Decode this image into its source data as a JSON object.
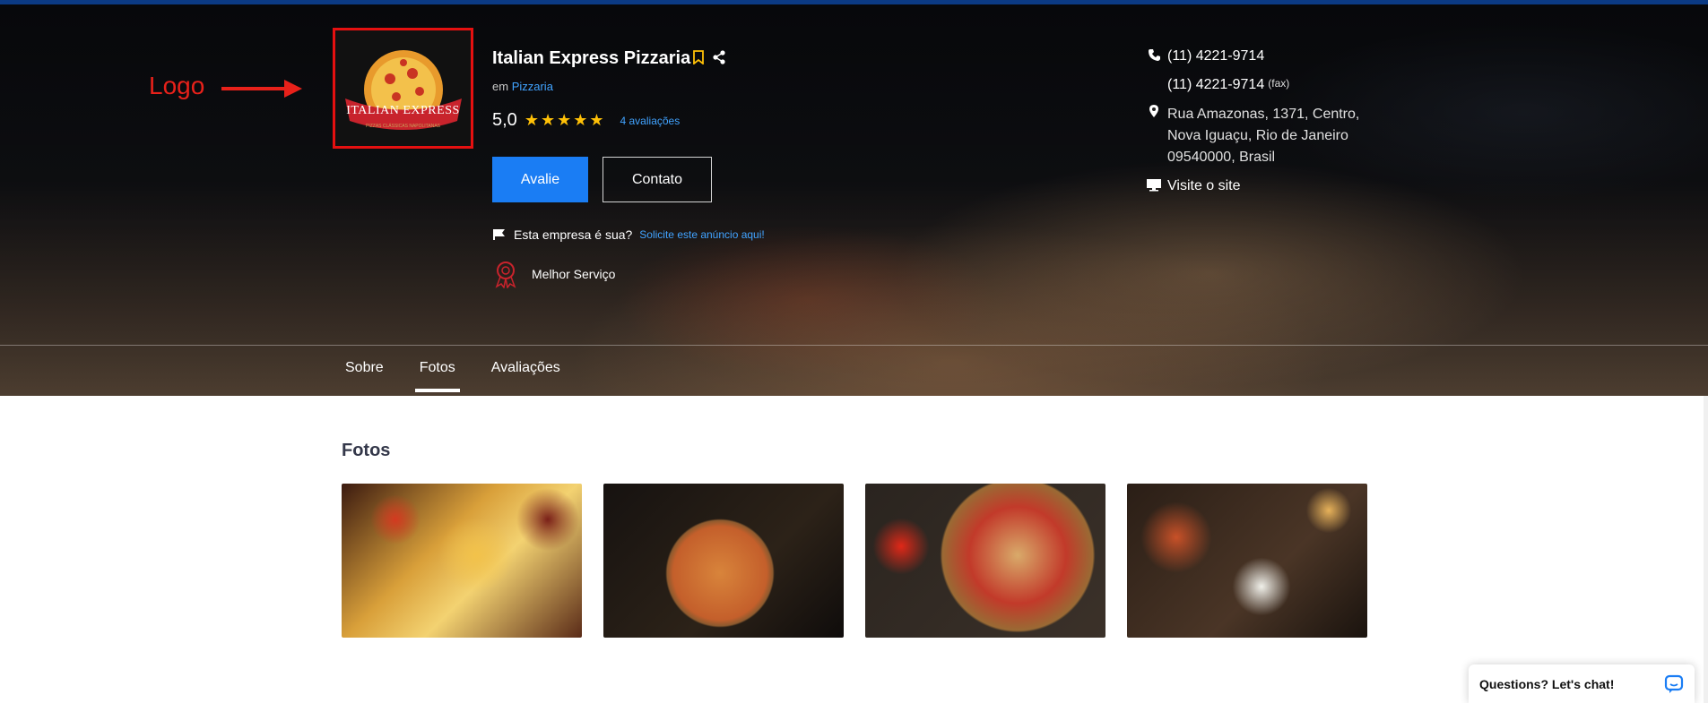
{
  "annotation": {
    "label": "Logo"
  },
  "logo": {
    "text": "ITALIAN EXPRESS",
    "subtext": "PIZZAS CLÁSSICAS NAPOLITANAS"
  },
  "business": {
    "name": "Italian Express Pizzaria",
    "category_prefix": "em",
    "category": "Pizzaria",
    "rating": "5,0",
    "stars": 5,
    "reviews_label": "4 avaliações"
  },
  "actions": {
    "review_label": "Avalie",
    "contact_label": "Contato"
  },
  "claim": {
    "question": "Esta empresa é sua?",
    "link": "Solicite este anúncio aqui!"
  },
  "badge": {
    "label": "Melhor Serviço"
  },
  "contact": {
    "phone": "(11) 4221-9714",
    "fax": "(11) 4221-9714",
    "fax_suffix": "(fax)",
    "address_line1": "Rua Amazonas, 1371, Centro,",
    "address_line2": "Nova Iguaçu, Rio de Janeiro",
    "address_line3": "09540000, Brasil",
    "website_label": "Visite o site"
  },
  "tabs": [
    {
      "label": "Sobre",
      "active": false
    },
    {
      "label": "Fotos",
      "active": true
    },
    {
      "label": "Avaliações",
      "active": false
    }
  ],
  "photos_section": {
    "title": "Fotos"
  },
  "chat": {
    "label": "Questions? Let's chat!"
  },
  "colors": {
    "accent": "#1a7df4",
    "link": "#41a3ff",
    "star": "#ffc107",
    "annotation": "#e51010"
  }
}
